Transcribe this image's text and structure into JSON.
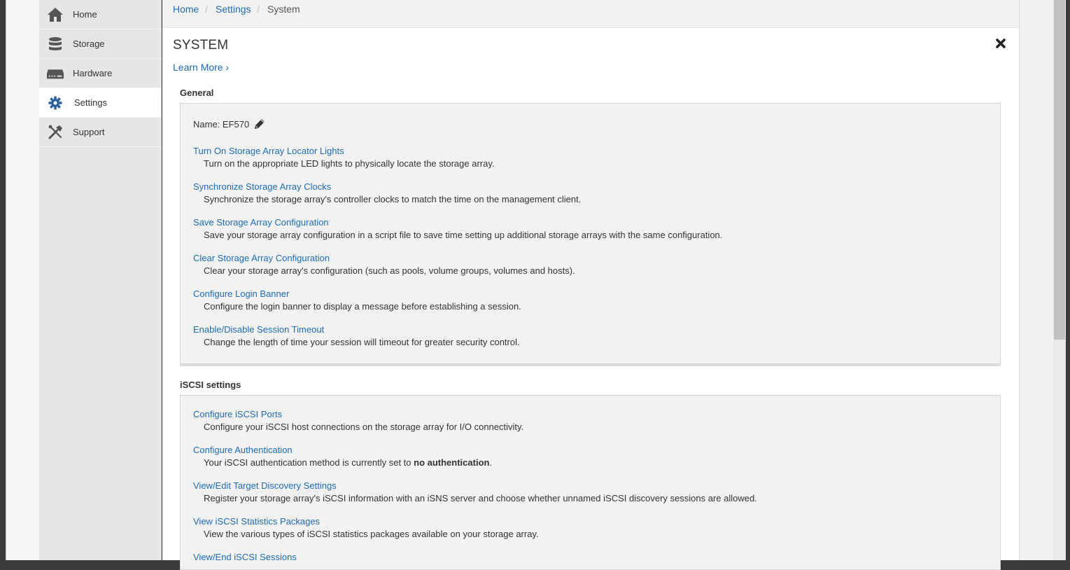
{
  "sidebar": {
    "items": [
      {
        "label": "Home",
        "icon": "home-icon"
      },
      {
        "label": "Storage",
        "icon": "database-icon"
      },
      {
        "label": "Hardware",
        "icon": "hardware-icon"
      },
      {
        "label": "Settings",
        "icon": "gear-icon",
        "active": true
      },
      {
        "label": "Support",
        "icon": "tools-icon"
      }
    ]
  },
  "breadcrumb": {
    "home": "Home",
    "settings": "Settings",
    "separator": "/",
    "current": "System"
  },
  "page": {
    "title": "SYSTEM",
    "learn_more": "Learn More ›"
  },
  "general": {
    "heading": "General",
    "name_label": "Name: EF570",
    "items": [
      {
        "link": "Turn On Storage Array Locator Lights",
        "desc": "Turn on the appropriate LED lights to physically locate the storage array."
      },
      {
        "link": "Synchronize Storage Array Clocks",
        "desc": "Synchronize the storage array's controller clocks to match the time on the management client."
      },
      {
        "link": "Save Storage Array Configuration",
        "desc": "Save your storage array configuration in a script file to save time setting up additional storage arrays with the same configuration."
      },
      {
        "link": "Clear Storage Array Configuration",
        "desc": "Clear your storage array's configuration (such as pools, volume groups, volumes and hosts)."
      },
      {
        "link": "Configure Login Banner",
        "desc": "Configure the login banner to display a message before establishing a session."
      },
      {
        "link": "Enable/Disable Session Timeout",
        "desc": "Change the length of time your session will timeout for greater security control."
      }
    ]
  },
  "iscsi": {
    "heading": "iSCSI settings",
    "items": [
      {
        "link": "Configure iSCSI Ports",
        "desc": "Configure your iSCSI host connections on the storage array for I/O connectivity."
      },
      {
        "link": "Configure Authentication",
        "desc_prefix": "Your iSCSI authentication method is currently set to ",
        "desc_bold": "no authentication",
        "desc_suffix": "."
      },
      {
        "link": "View/Edit Target Discovery Settings",
        "desc": "Register your storage array's iSCSI information with an iSNS server and choose whether unnamed iSCSI discovery sessions are allowed."
      },
      {
        "link": "View iSCSI Statistics Packages",
        "desc": "View the various types of iSCSI statistics packages available on your storage array."
      },
      {
        "link": "View/End iSCSI Sessions",
        "desc": ""
      }
    ]
  },
  "colors": {
    "link": "#1e6bb8",
    "panel_bg": "#f2f2f2",
    "sidebar_bg": "#e6e6e6"
  }
}
